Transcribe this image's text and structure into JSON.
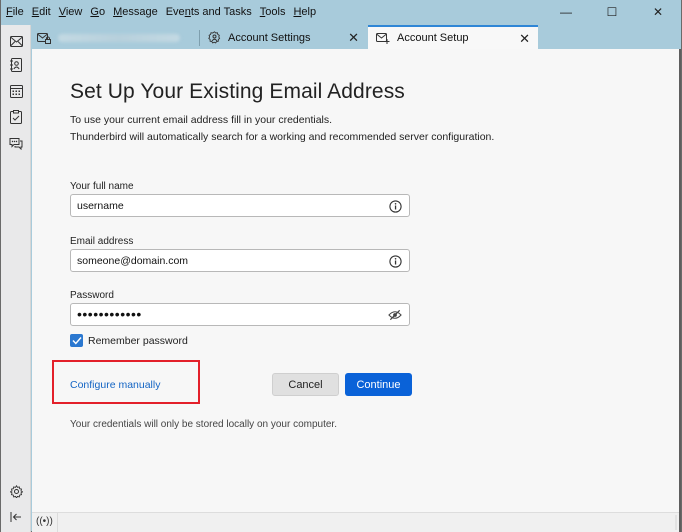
{
  "menubar": {
    "items": [
      {
        "label": "File",
        "accel": "F"
      },
      {
        "label": "Edit",
        "accel": "E"
      },
      {
        "label": "View",
        "accel": "V"
      },
      {
        "label": "Go",
        "accel": "G"
      },
      {
        "label": "Message",
        "accel": "M"
      },
      {
        "label": "Events and Tasks",
        "accel": "n"
      },
      {
        "label": "Tools",
        "accel": "T"
      },
      {
        "label": "Help",
        "accel": "H"
      }
    ]
  },
  "window_controls": {
    "minimize": "—",
    "maximize": "☐",
    "close": "✕"
  },
  "spaces": [
    {
      "name": "mail",
      "icon": "mail-icon"
    },
    {
      "name": "address-book",
      "icon": "address-book-icon"
    },
    {
      "name": "calendar",
      "icon": "calendar-icon"
    },
    {
      "name": "tasks",
      "icon": "tasks-icon"
    },
    {
      "name": "chat",
      "icon": "chat-icon"
    }
  ],
  "spaces_bottom": {
    "settings_icon": "gear-icon",
    "collapse_icon": "collapse-icon"
  },
  "tabs": [
    {
      "label": "",
      "icon": "mail-lock-icon",
      "redacted": true,
      "active": false
    },
    {
      "label": "Account Settings",
      "icon": "account-settings-icon",
      "active": false
    },
    {
      "label": "Account Setup",
      "icon": "mail-add-icon",
      "active": true
    }
  ],
  "tab_close_glyph": "✕",
  "setup": {
    "title": "Set Up Your Existing Email Address",
    "intro_line1": "To use your current email address fill in your credentials.",
    "intro_line2": "Thunderbird will automatically search for a working and recommended server configuration.",
    "fields": {
      "name": {
        "label": "Your full name",
        "value": "username"
      },
      "email": {
        "label": "Email address",
        "value": "someone@domain.com"
      },
      "password": {
        "label": "Password",
        "value": "••••••••••••"
      }
    },
    "remember_password": {
      "label": "Remember password",
      "checked": true
    },
    "configure_manually": "Configure manually",
    "cancel": "Cancel",
    "continue": "Continue",
    "footnote": "Your credentials will only be stored locally on your computer."
  },
  "statusbar": {
    "activity_icon": "((•))"
  },
  "colors": {
    "accent": "#0a62d8",
    "link": "#1465c4",
    "highlight": "#e3202a",
    "titlebar": "#a8cbdb"
  }
}
